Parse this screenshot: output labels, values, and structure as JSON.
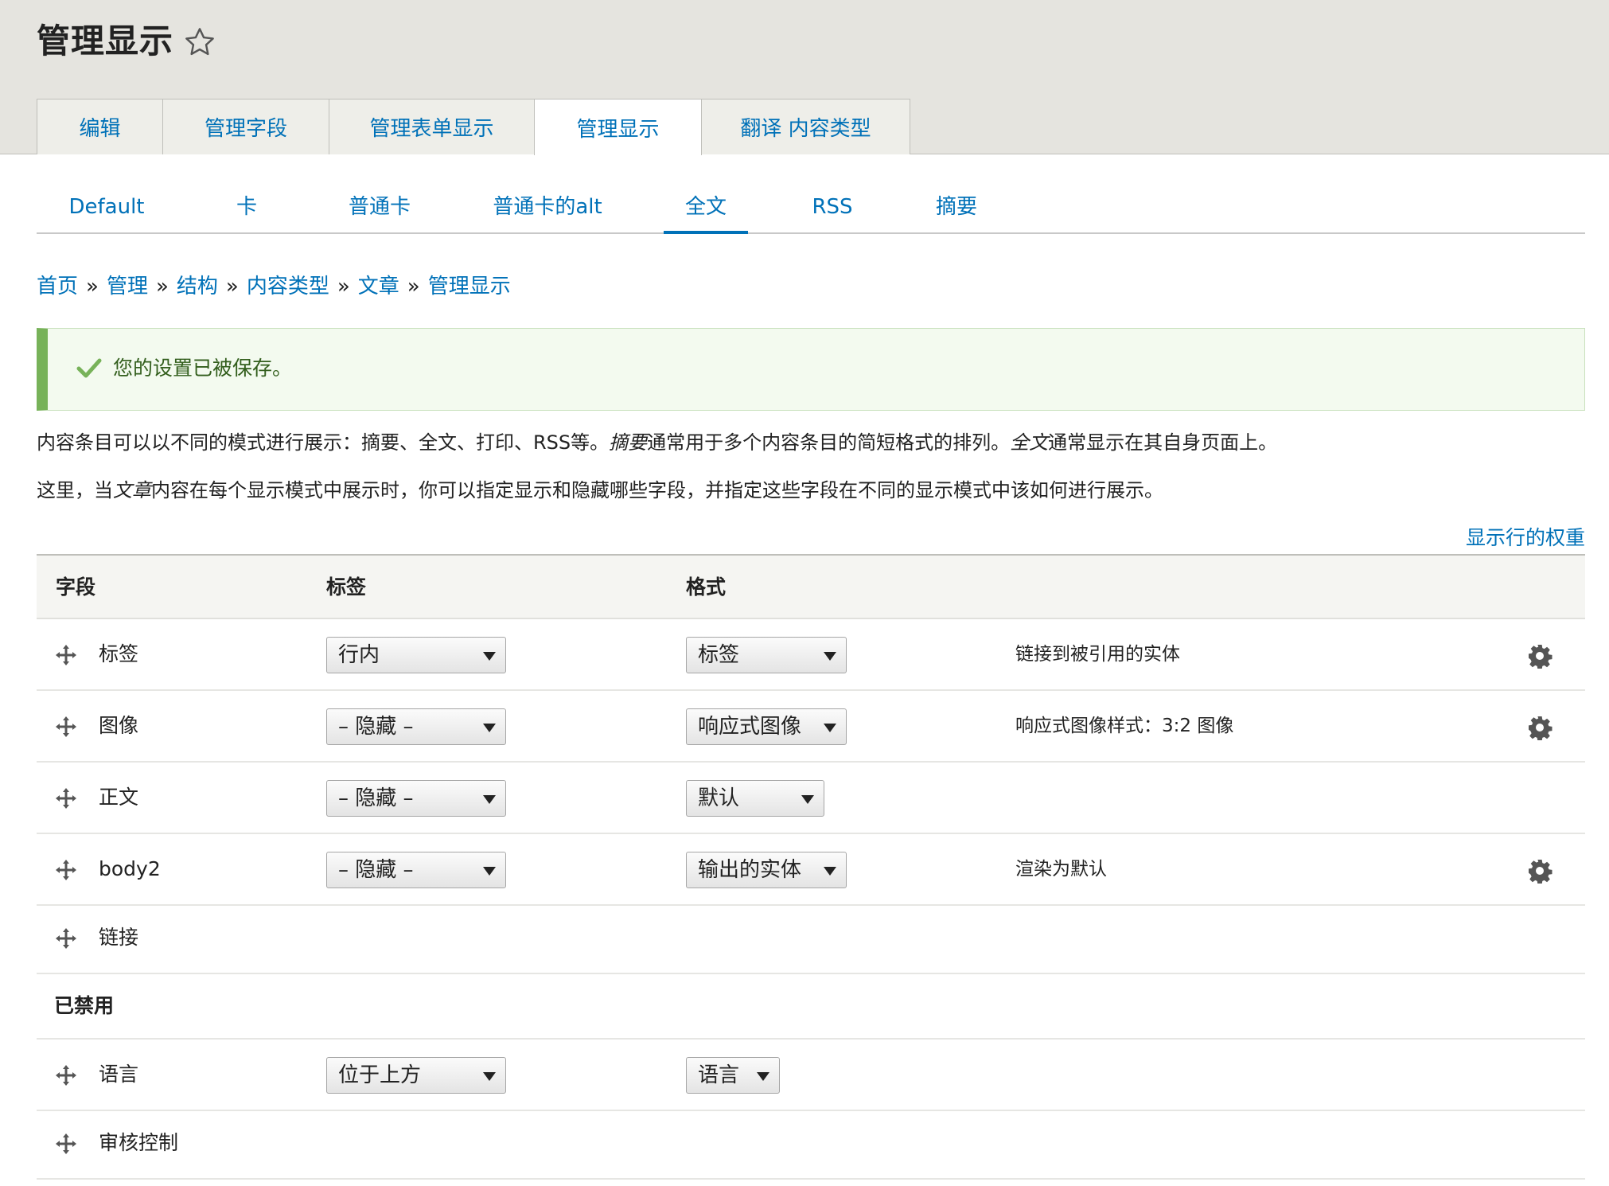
{
  "header": {
    "title": "管理显示",
    "primary_tabs": [
      {
        "label": "编辑"
      },
      {
        "label": "管理字段"
      },
      {
        "label": "管理表单显示"
      },
      {
        "label": "管理显示",
        "active": true
      },
      {
        "label": "翻译 内容类型"
      }
    ]
  },
  "view_modes": [
    {
      "label": "Default"
    },
    {
      "label": "卡"
    },
    {
      "label": "普通卡"
    },
    {
      "label": "普通卡的alt"
    },
    {
      "label": "全文",
      "active": true
    },
    {
      "label": "RSS"
    },
    {
      "label": "摘要"
    }
  ],
  "breadcrumb": {
    "items": [
      "首页",
      "管理",
      "结构",
      "内容类型",
      "文章",
      "管理显示"
    ],
    "separator": "»"
  },
  "message": {
    "status": "success",
    "text": "您的设置已被保存。"
  },
  "description": {
    "line1": {
      "a": "内容条目可以以不同的模式进行展示：摘要、全文、打印、RSS等。",
      "b": "摘要",
      "c": "通常用于多个内容条目的简短格式的排列。",
      "d": "全文",
      "e": "通常显示在其自身页面上。"
    },
    "line2": {
      "a": "这里，当",
      "b": "文章",
      "c": "内容在每个显示模式中展示时，你可以指定显示和隐藏哪些字段，并指定这些字段在不同的显示模式中该如何进行展示。"
    }
  },
  "show_weights_link": "显示行的权重",
  "table": {
    "headers": {
      "field": "字段",
      "label": "标签",
      "format": "格式"
    },
    "rows": [
      {
        "name": "标签",
        "label": "行内",
        "format": "标签",
        "summary": "链接到被引用的实体",
        "has_settings": true
      },
      {
        "name": "图像",
        "label": "– 隐藏 –",
        "format": "响应式图像",
        "summary": "响应式图像样式：3:2 图像",
        "has_settings": true
      },
      {
        "name": "正文",
        "label": "– 隐藏 –",
        "format": "默认",
        "summary": "",
        "has_settings": false
      },
      {
        "name": "body2",
        "label": "– 隐藏 –",
        "format": "输出的实体",
        "summary": "渲染为默认",
        "has_settings": true
      },
      {
        "name": "链接"
      }
    ],
    "disabled_region": "已禁用",
    "disabled_rows": [
      {
        "name": "语言",
        "label": "位于上方",
        "format": "语言"
      },
      {
        "name": "审核控制"
      }
    ]
  },
  "colors": {
    "link": "#0071b8",
    "header_bg": "#e5e4df",
    "success_border": "#77b259",
    "success_bg": "#f3faef",
    "success_text": "#325e1c"
  },
  "icons": [
    "star-icon",
    "check-icon",
    "drag-icon",
    "gear-icon",
    "dropdown-arrow-icon"
  ]
}
